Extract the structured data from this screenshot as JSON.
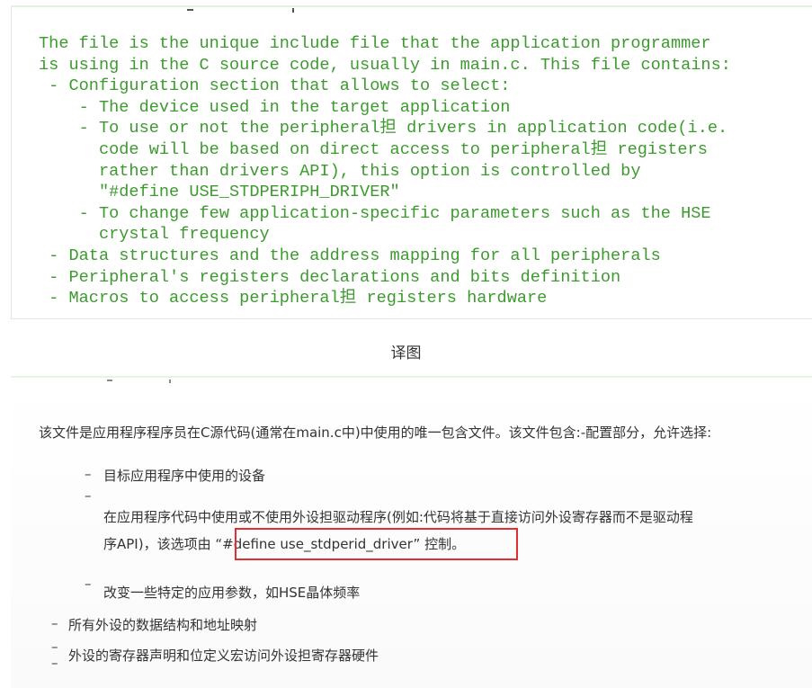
{
  "original": {
    "lines": [
      "The file is the unique include file that the application programmer",
      "is using in the C source code, usually in main.c. This file contains:",
      " - Configuration section that allows to select:",
      "    - The device used in the target application",
      "    - To use or not the peripheral担 drivers in application code(i.e.",
      "      code will be based on direct access to peripheral担 registers",
      "      rather than drivers API), this option is controlled by",
      "      \"#define USE_STDPERIPH_DRIVER\"",
      "    - To change few application-specific parameters such as the HSE",
      "      crystal frequency",
      " - Data structures and the address mapping for all peripherals",
      " - Peripheral's registers declarations and bits definition",
      " - Macros to access peripheral担 registers hardware"
    ]
  },
  "caption": "译图",
  "translation": {
    "intro": "该文件是应用程序程序员在C源代码(通常在main.c中)中使用的唯一包含文件。该文件包含:-配置部分，允许选择:",
    "item1": "目标应用程序中使用的设备",
    "item2_line1": "在应用程序代码中使用或不使用外设担驱动程序(例如:代码将基于直接访问外设寄存器而不是驱动程",
    "item2_line2_pre": "序API)，该选项由",
    "item2_highlight": "“#define use_stdperid_driver”",
    "item2_post": "控制。",
    "item3": "改变一些特定的应用参数，如HSE晶体频率",
    "item4": "所有外设的数据结构和地址映射",
    "item5": "外设的寄存器声明和位定义宏访问外设担寄存器硬件",
    "dash": "–"
  },
  "colors": {
    "code_green": "#3c9a2e",
    "highlight_red": "#e03030"
  }
}
